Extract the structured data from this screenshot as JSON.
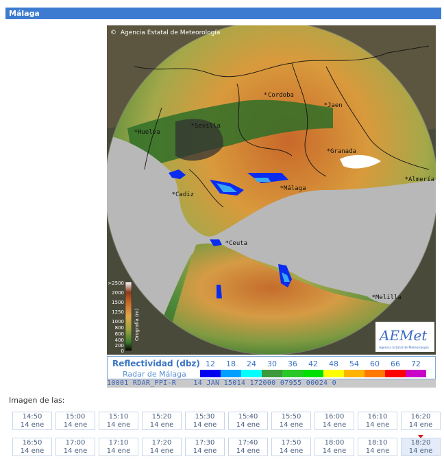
{
  "header": {
    "title": "Málaga"
  },
  "map": {
    "attribution": "Agencia Estatal de Meteorología",
    "copyright_symbol": "©",
    "cities": [
      {
        "name": "Cordoba"
      },
      {
        "name": "Jaen"
      },
      {
        "name": "Huelva"
      },
      {
        "name": "Sevilla"
      },
      {
        "name": "Granada"
      },
      {
        "name": "Málaga"
      },
      {
        "name": "Cadiz"
      },
      {
        "name": "Ceuta"
      },
      {
        "name": "Melilla"
      },
      {
        "name": "Almería"
      }
    ],
    "orography": {
      "label": "Orografía (m)",
      "ticks": [
        ">2500",
        "2000",
        "1500",
        "1250",
        "1000",
        "800",
        "600",
        "400",
        "200",
        "0"
      ]
    },
    "logo": {
      "text": "AEMet",
      "subtitle": "Agencia Estatal de Meteorología"
    }
  },
  "legend": {
    "title": "Reflectividad (dbz)",
    "subtitle": "Radar de Málaga",
    "scale": [
      {
        "value": "12",
        "color": "#0000f0"
      },
      {
        "value": "18",
        "color": "#00a0ff"
      },
      {
        "value": "24",
        "color": "#00ffff"
      },
      {
        "value": "30",
        "color": "#3c9a3c"
      },
      {
        "value": "36",
        "color": "#28c828"
      },
      {
        "value": "42",
        "color": "#00e000"
      },
      {
        "value": "48",
        "color": "#ffff00"
      },
      {
        "value": "54",
        "color": "#ffb400"
      },
      {
        "value": "60",
        "color": "#ff7800"
      },
      {
        "value": "66",
        "color": "#ff0000"
      },
      {
        "value": "72",
        "color": "#c800c8"
      }
    ]
  },
  "status_strip": {
    "text": "10001 RDAR_PPI-R    14 JAN 15014 172000 07955 00024 0"
  },
  "times": {
    "label": "Imagen de las:",
    "row1": [
      {
        "time": "14:50",
        "date": "14 ene"
      },
      {
        "time": "15:00",
        "date": "14 ene"
      },
      {
        "time": "15:10",
        "date": "14 ene"
      },
      {
        "time": "15:20",
        "date": "14 ene"
      },
      {
        "time": "15:30",
        "date": "14 ene"
      },
      {
        "time": "15:40",
        "date": "14 ene"
      },
      {
        "time": "15:50",
        "date": "14 ene"
      },
      {
        "time": "16:00",
        "date": "14 ene"
      },
      {
        "time": "16:10",
        "date": "14 ene"
      },
      {
        "time": "16:20",
        "date": "14 ene"
      }
    ],
    "row2": [
      {
        "time": "16:50",
        "date": "14 ene"
      },
      {
        "time": "17:00",
        "date": "14 ene"
      },
      {
        "time": "17:10",
        "date": "14 ene"
      },
      {
        "time": "17:20",
        "date": "14 ene"
      },
      {
        "time": "17:30",
        "date": "14 ene"
      },
      {
        "time": "17:40",
        "date": "14 ene"
      },
      {
        "time": "17:50",
        "date": "14 ene"
      },
      {
        "time": "18:00",
        "date": "14 ene"
      },
      {
        "time": "18:10",
        "date": "14 ene"
      },
      {
        "time": "18:20",
        "date": "14 ene"
      }
    ],
    "active": "18:20"
  }
}
